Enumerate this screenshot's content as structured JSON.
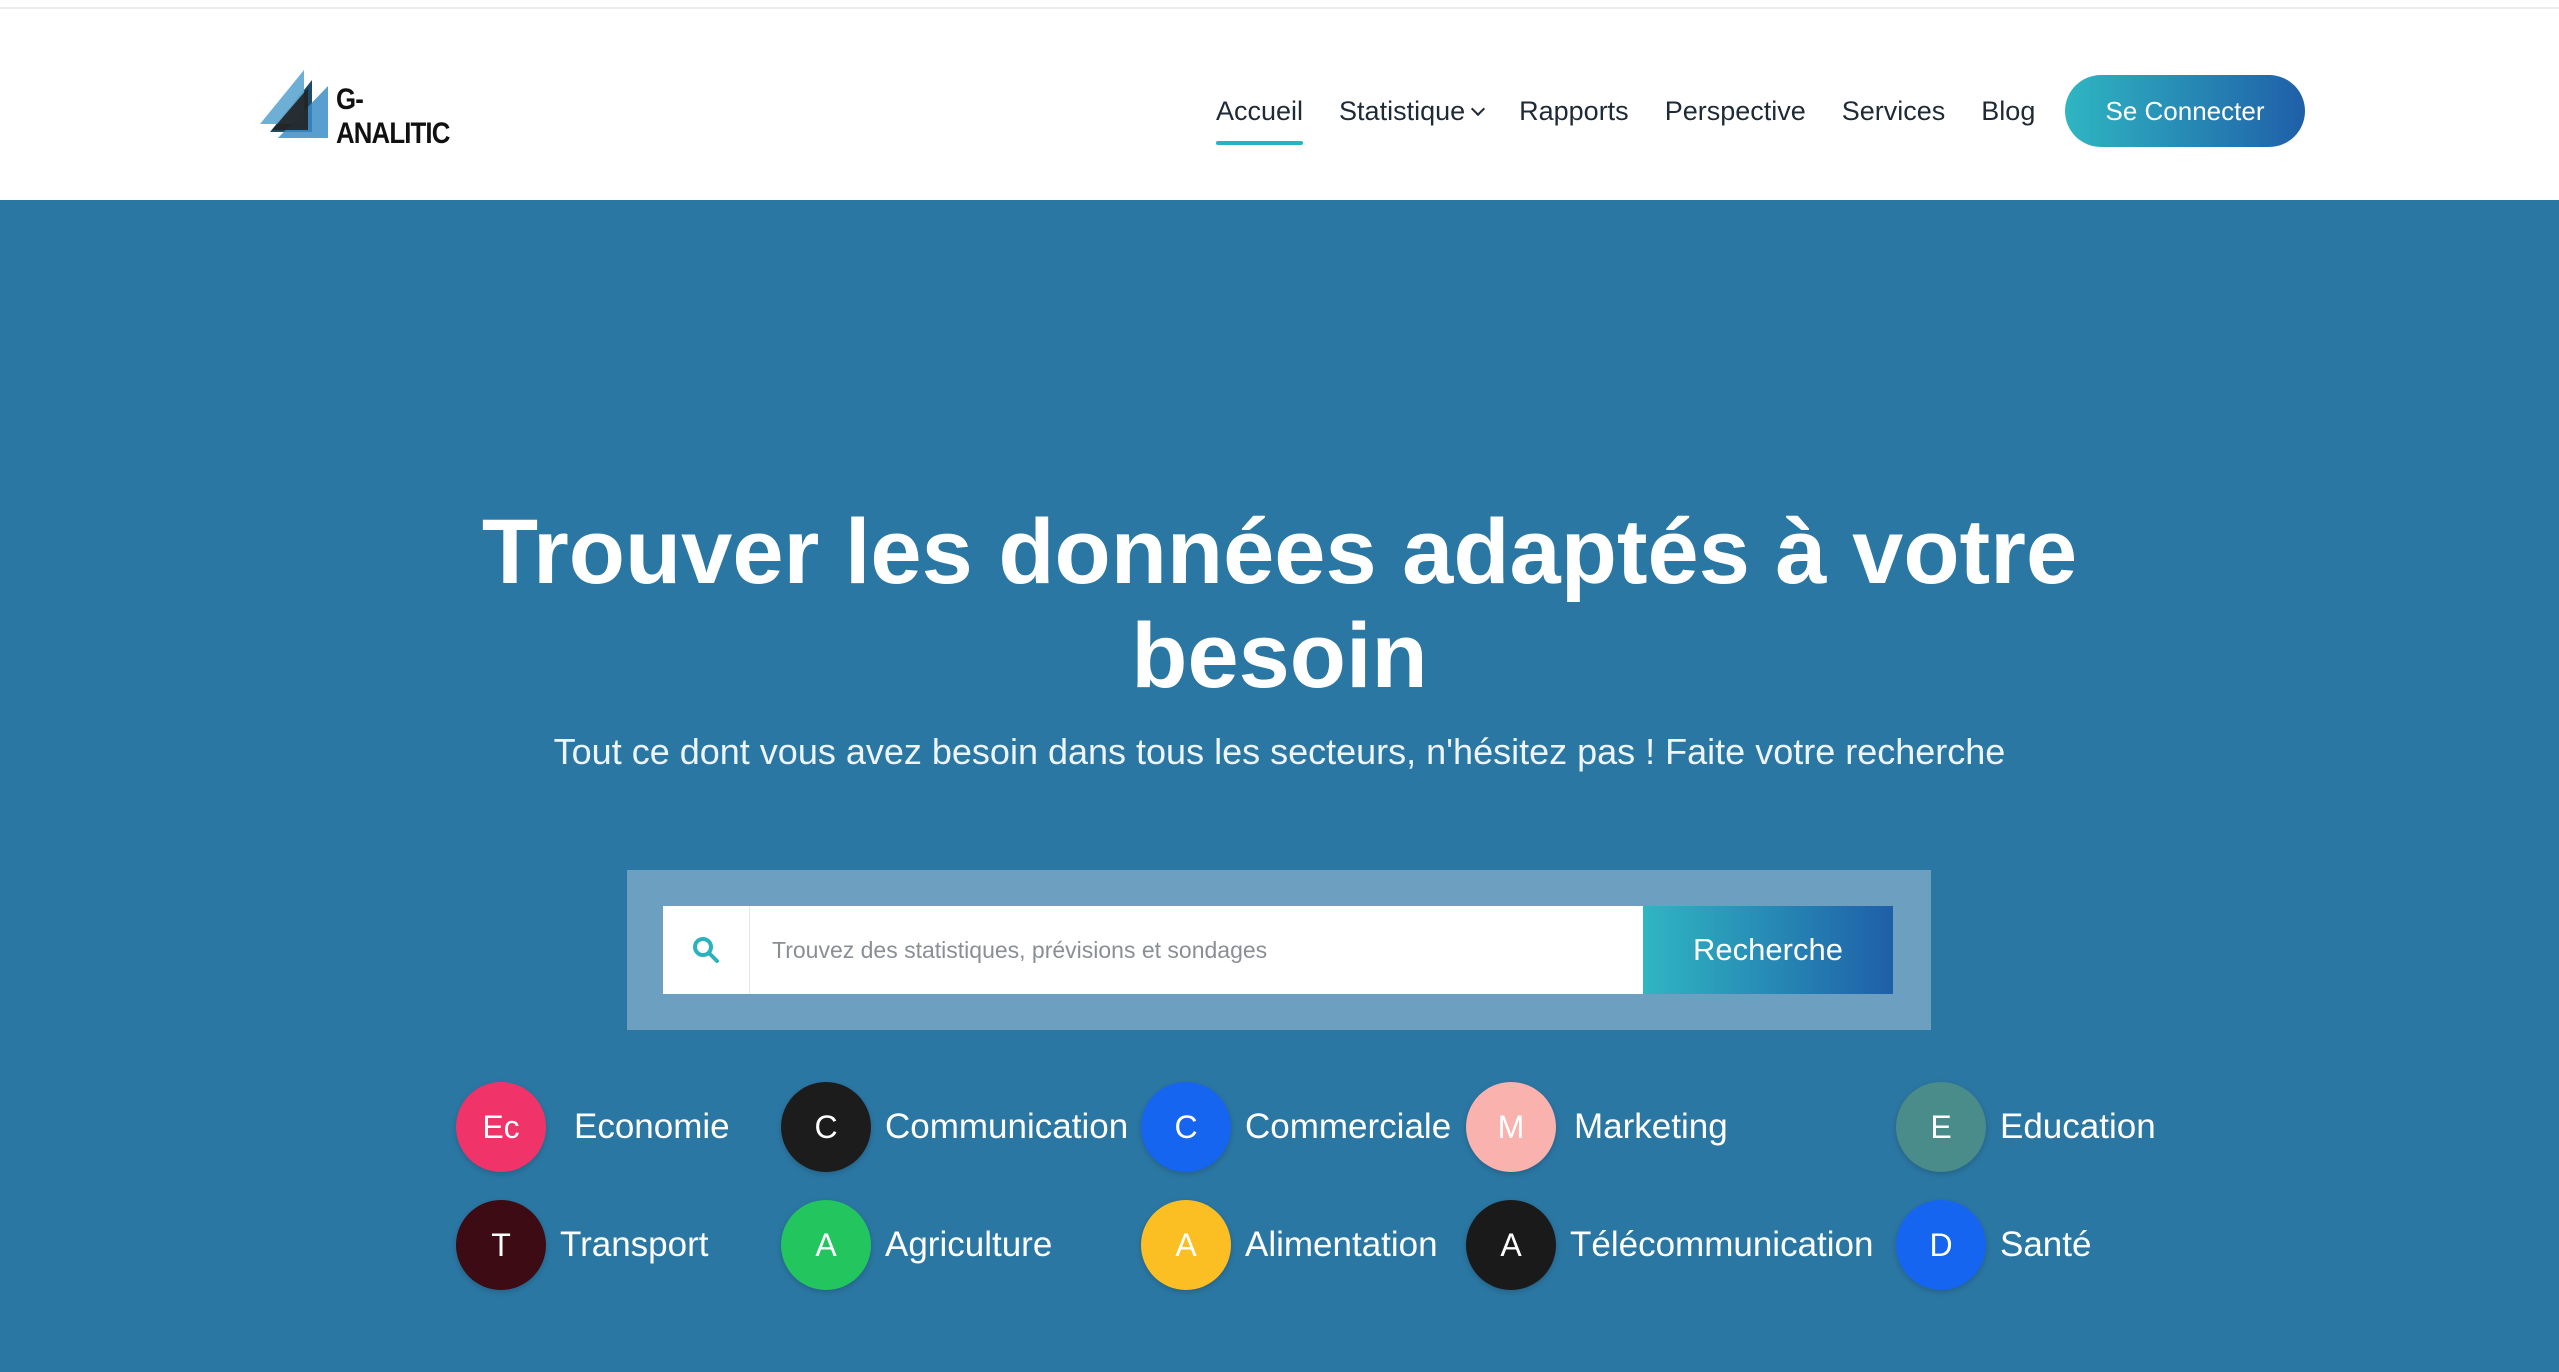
{
  "brand": {
    "name": "G-ANALITIC"
  },
  "nav": {
    "items": [
      {
        "label": "Accueil",
        "active": true
      },
      {
        "label": "Statistique",
        "dropdown": true
      },
      {
        "label": "Rapports"
      },
      {
        "label": "Perspective"
      },
      {
        "label": "Services"
      },
      {
        "label": "Blog"
      }
    ],
    "login_label": "Se Connecter"
  },
  "hero": {
    "title_line1": "Trouver les données adaptés à votre",
    "title_line2": "besoin",
    "subtitle": "Tout ce dont vous avez besoin dans tous les secteurs, n'hésitez pas ! Faite votre recherche"
  },
  "search": {
    "placeholder": "Trouvez des statistiques, prévisions et sondages",
    "value": "",
    "button_label": "Recherche"
  },
  "categories": [
    {
      "initial": "Ec",
      "label": "Economie",
      "color": "#f0346a"
    },
    {
      "initial": "C",
      "label": "Communication",
      "color": "#1c1c1c"
    },
    {
      "initial": "C",
      "label": "Commerciale",
      "color": "#1565f0"
    },
    {
      "initial": "M",
      "label": "Marketing",
      "color": "#f9b2ae"
    },
    {
      "initial": "E",
      "label": "Education",
      "color": "#4a8c8a"
    },
    {
      "initial": "T",
      "label": "Transport",
      "color": "#3d0b14"
    },
    {
      "initial": "A",
      "label": "Agriculture",
      "color": "#22c55e"
    },
    {
      "initial": "A",
      "label": "Alimentation",
      "color": "#fbbf24"
    },
    {
      "initial": "A",
      "label": "Télécommunication",
      "color": "#1a1a1a"
    },
    {
      "initial": "D",
      "label": "Santé",
      "color": "#1565f0"
    }
  ],
  "colors": {
    "hero_bg": "#2b77a3",
    "accent": "#2ab3bf",
    "gradient_end": "#1f5fa8"
  }
}
